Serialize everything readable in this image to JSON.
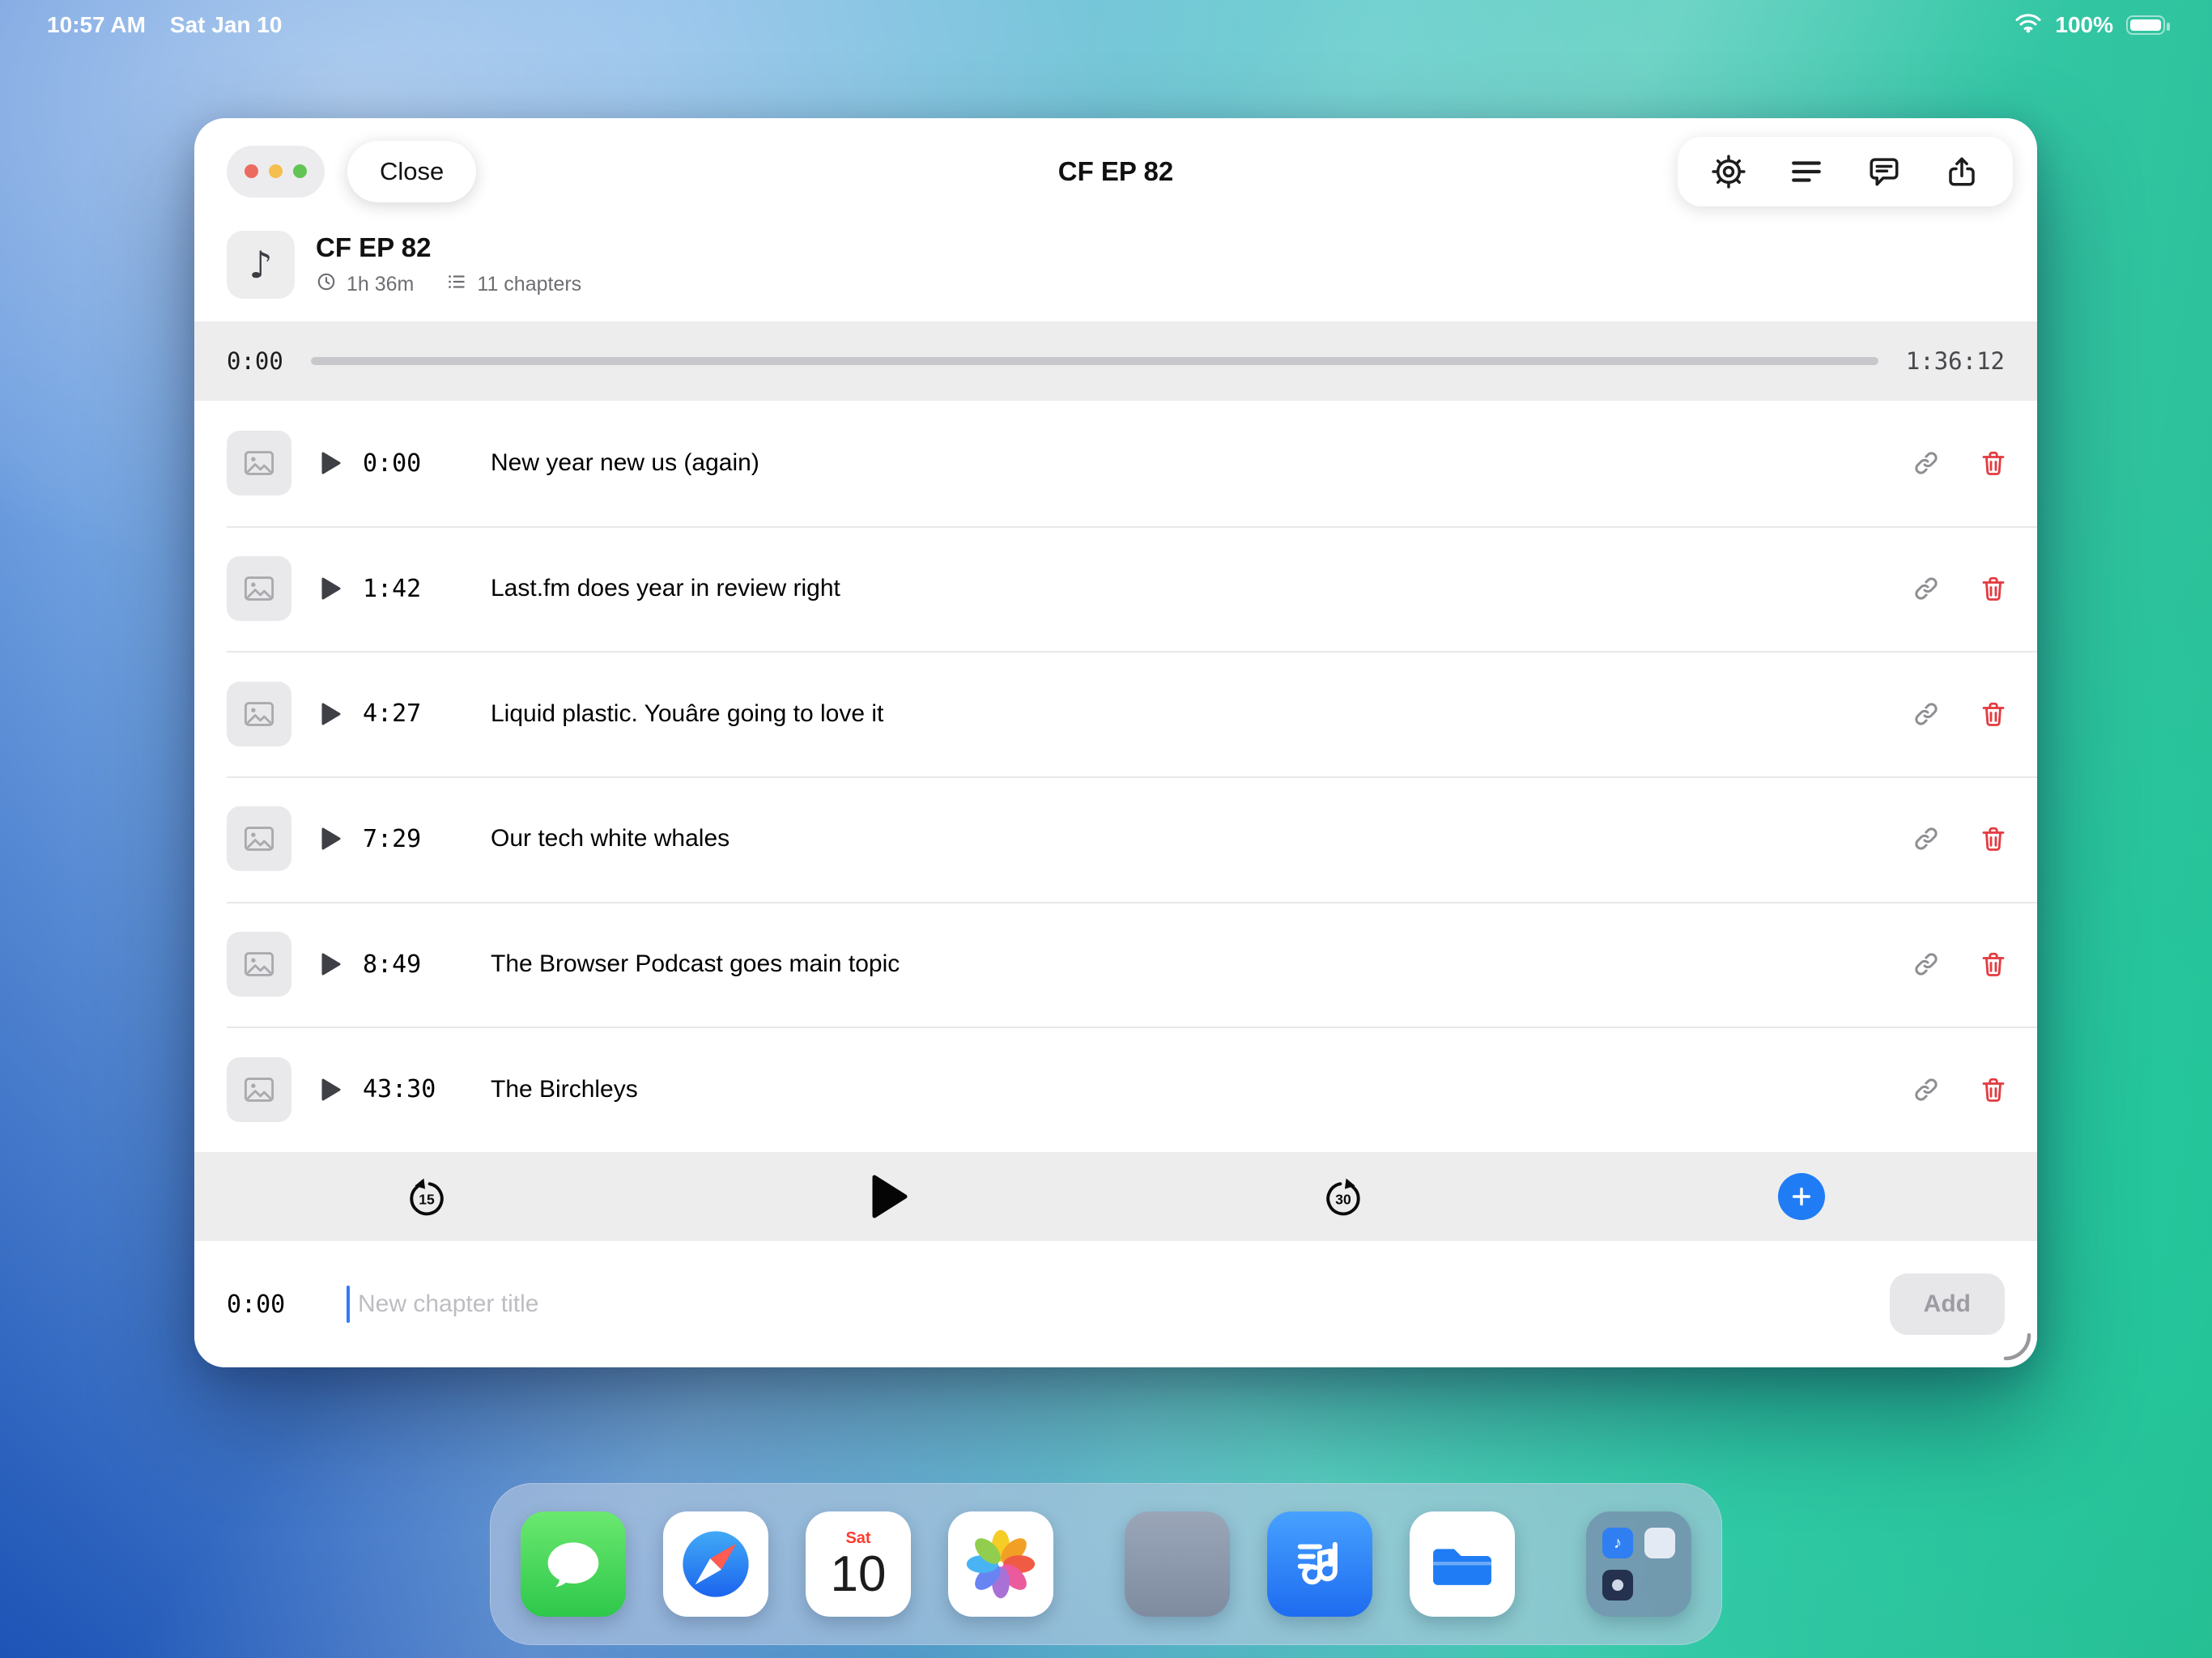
{
  "status_bar": {
    "time": "10:57 AM",
    "date": "Sat Jan 10",
    "battery_percent": "100%"
  },
  "window": {
    "header": {
      "close_label": "Close",
      "title": "CF EP 82"
    },
    "episode": {
      "title": "CF EP 82",
      "duration": "1h 36m",
      "chapters_count": "11 chapters"
    },
    "progress": {
      "elapsed": "0:00",
      "total": "1:36:12"
    },
    "chapters": [
      {
        "time": "0:00",
        "title": "New year new us (again)"
      },
      {
        "time": "1:42",
        "title": "Last.fm does year in review right"
      },
      {
        "time": "4:27",
        "title": "Liquid plastic. Youâre going to love it"
      },
      {
        "time": "7:29",
        "title": "Our tech white whales"
      },
      {
        "time": "8:49",
        "title": "The Browser Podcast goes main topic"
      },
      {
        "time": "43:30",
        "title": "The Birchleys"
      }
    ],
    "player": {
      "skip_back_label": "15",
      "skip_forward_label": "30"
    },
    "composer": {
      "time": "0:00",
      "placeholder": "New chapter title",
      "add_label": "Add"
    }
  },
  "dock": {
    "calendar": {
      "weekday": "Sat",
      "day": "10"
    },
    "apps": [
      "messages",
      "safari",
      "calendar",
      "photos",
      "placeholder-app",
      "music-playlists",
      "files",
      "app-folder"
    ]
  },
  "colors": {
    "accent_blue": "#1f7cf5",
    "destructive_red": "#e23b41",
    "traffic_red": "#ed6a5f",
    "traffic_yellow": "#f5bf4f",
    "traffic_green": "#61c554",
    "bar_gray": "#ededee"
  },
  "icons": [
    "wifi-icon",
    "battery-icon",
    "window-controls-dots",
    "settings-gear-icon",
    "queue-list-icon",
    "comment-icon",
    "share-icon",
    "music-note-icon",
    "clock-icon",
    "chapter-count-icon",
    "photo-placeholder-icon",
    "play-icon",
    "link-icon",
    "trash-icon",
    "skip-back-15-icon",
    "skip-forward-30-icon",
    "add-plus-icon",
    "text-caret",
    "resize-handle-icon"
  ]
}
